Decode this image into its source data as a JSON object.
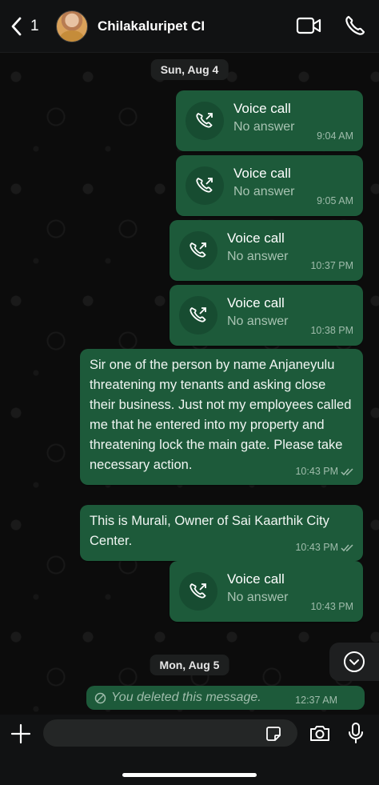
{
  "header": {
    "back_count": "1",
    "contact_name": "Chilakaluripet CI",
    "icons": [
      "chevron-left-icon",
      "video-call-icon",
      "phone-icon"
    ]
  },
  "chat": {
    "date1": "Sun, Aug 4",
    "date2": "Mon, Aug 5",
    "calls": [
      {
        "title": "Voice call",
        "status": "No answer",
        "time": "9:04 AM"
      },
      {
        "title": "Voice call",
        "status": "No answer",
        "time": "9:05 AM"
      },
      {
        "title": "Voice call",
        "status": "No answer",
        "time": "10:37 PM"
      },
      {
        "title": "Voice call",
        "status": "No answer",
        "time": "10:38 PM"
      },
      {
        "title": "Voice call",
        "status": "No answer",
        "time": "10:43 PM"
      }
    ],
    "messages": [
      {
        "text": "Sir one of the person by name Anjaneyulu threatening my tenants and asking close their business. Just not my employees called me that he entered into my property and threatening lock the main gate. Please take necessary action.",
        "time": "10:43 PM"
      },
      {
        "text": "This is Murali, Owner of Sai Kaarthik City Center.",
        "time": "10:43 PM"
      }
    ],
    "deleted": {
      "text": "You deleted this message.",
      "time": "12:37 AM"
    }
  },
  "footer": {
    "input_placeholder": ""
  },
  "colors": {
    "bubble": "#1d5a3a",
    "background": "#0c0c0c",
    "header": "#111213"
  }
}
